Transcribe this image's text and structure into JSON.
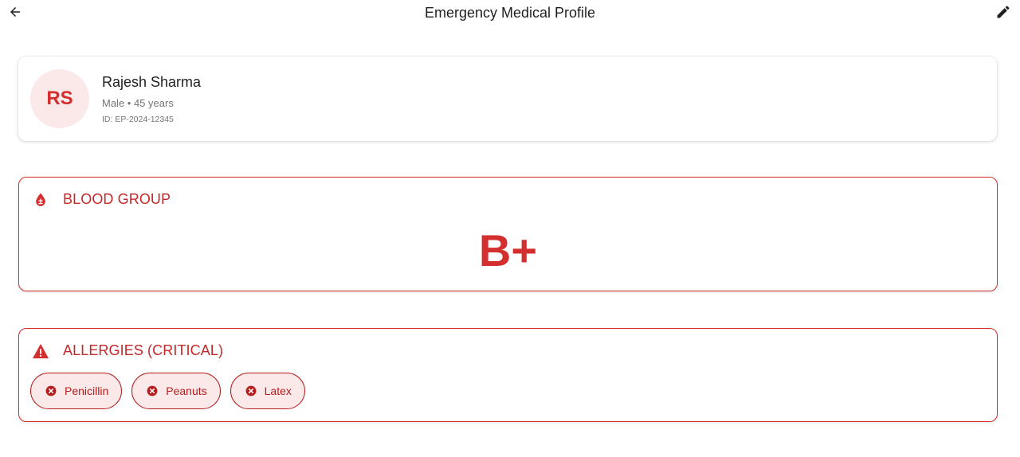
{
  "header": {
    "title": "Emergency Medical Profile",
    "back_icon": "arrow-back-icon",
    "edit_icon": "edit-pencil-icon"
  },
  "profile": {
    "initials": "RS",
    "name": "Rajesh Sharma",
    "meta": "Male • 45 years",
    "id_text": "ID: EP-2024-12345"
  },
  "blood_group": {
    "title": "BLOOD GROUP",
    "icon": "blood-drop-icon",
    "value": "B+"
  },
  "allergies": {
    "title": "ALLERGIES (CRITICAL)",
    "icon": "warning-triangle-icon",
    "chip_icon": "cancel-circle-icon",
    "items": [
      {
        "label": "Penicillin"
      },
      {
        "label": "Peanuts"
      },
      {
        "label": "Latex"
      }
    ]
  },
  "colors": {
    "accent_red": "#d32f2f",
    "chip_background": "#fbe9e9",
    "chip_border": "#b71c1c"
  }
}
